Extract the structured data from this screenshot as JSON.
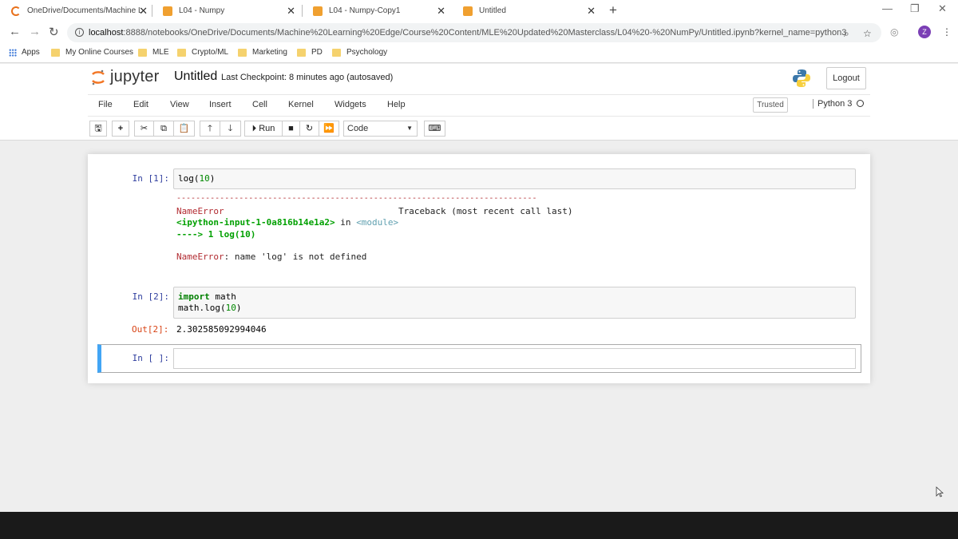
{
  "browser": {
    "tabs": [
      {
        "title": "OneDrive/Documents/Machine L",
        "icon": "onedrive-icon",
        "active": false
      },
      {
        "title": "L04 - Numpy",
        "icon": "jupyter-icon",
        "active": false
      },
      {
        "title": "L04 - Numpy-Copy1",
        "icon": "jupyter-icon",
        "active": false
      },
      {
        "title": "Untitled",
        "icon": "jupyter-icon",
        "active": true
      }
    ],
    "new_tab": "+",
    "url_host": "localhost",
    "url_rest": ":8888/notebooks/OneDrive/Documents/Machine%20Learning%20Edge/Course%20Content/MLE%20Updated%20Masterclass/L04%20-%20NumPy/Untitled.ipynb?kernel_name=python3",
    "avatar_letter": "Z",
    "bookmarks": [
      "Apps",
      "My Online Courses",
      "MLE",
      "Crypto/ML",
      "Marketing",
      "PD",
      "Psychology"
    ]
  },
  "jupyter": {
    "logo_text": "jupyter",
    "notebook_title": "Untitled",
    "checkpoint": "Last Checkpoint: 8 minutes ago",
    "autosave": "(autosaved)",
    "logout": "Logout",
    "menu": [
      "File",
      "Edit",
      "View",
      "Insert",
      "Cell",
      "Kernel",
      "Widgets",
      "Help"
    ],
    "trusted": "Trusted",
    "kernel_name": "Python 3",
    "toolbar": {
      "run": "Run",
      "cell_type": "Code"
    }
  },
  "cells": {
    "c1": {
      "prompt": "In [1]:",
      "code": "log(10)",
      "error": {
        "dashes": "---------------------------------------------------------------------------",
        "name": "NameError",
        "traceback": "Traceback (most recent call last)",
        "location": "<ipython-input-1-0a816b14e1a2>",
        "in": " in ",
        "module": "<module>",
        "arrow": "----> 1 log(10)",
        "message_name": "NameError",
        "message": ": name 'log' is not defined"
      }
    },
    "c2": {
      "prompt": "In [2]:",
      "code_line1": "import math",
      "code_line2": "math.log(10)",
      "out_prompt": "Out[2]:",
      "output": "2.302585092994046"
    },
    "c3": {
      "prompt": "In [ ]:"
    }
  },
  "colors": {
    "accent_selected_cell": "#42a5f5",
    "in_prompt": "#303f9f",
    "out_prompt": "#d84315",
    "error_red": "#b22b31"
  }
}
